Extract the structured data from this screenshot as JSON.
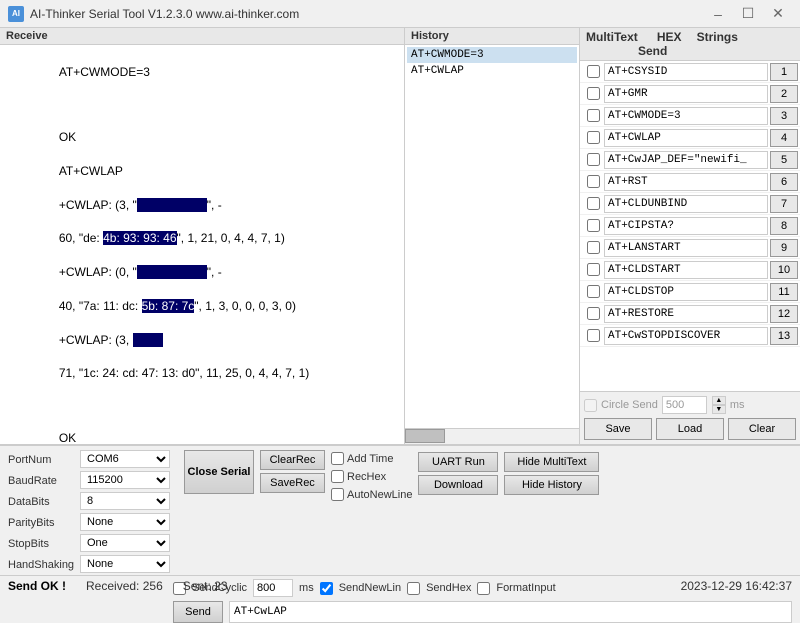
{
  "titlebar": {
    "title": "AI-Thinker Serial Tool V1.2.3.0    www.ai-thinker.com",
    "icon_label": "AI"
  },
  "receive": {
    "label": "Receive",
    "content_lines": [
      "AT+CWMODE=3",
      "",
      "OK",
      "AT+CWLAP",
      "+CWLAP: (3, \"[REDACTED]\", -",
      "60, \"de: 4b: 93: 93: 46\", 1, 21, 0, 4, 4, 7, 1)",
      "+CWLAP: (0, \"[REDACTED]\", -",
      "40, \"7a: 11: dc: 5b: 87: 7c\", 1, 3, 0, 0, 0, 3, 0)",
      "+CWLAP: (3, ",
      "71, \"1c: 24: cd: 47: 13: d0\", 11, 25, 0, 4, 4, 7, 1)",
      "",
      "OK"
    ]
  },
  "history": {
    "label": "History",
    "items": [
      {
        "text": "AT+CWMODE=3",
        "selected": false
      },
      {
        "text": "AT+CWLAP",
        "selected": false
      }
    ]
  },
  "multitext": {
    "label": "MultiText",
    "col_hex": "HEX",
    "col_strings": "Strings",
    "col_send": "Send",
    "rows": [
      {
        "checked": false,
        "value": "AT+CSYSID",
        "send_label": "1"
      },
      {
        "checked": false,
        "value": "AT+GMR",
        "send_label": "2"
      },
      {
        "checked": false,
        "value": "AT+CWMODE=3",
        "send_label": "3"
      },
      {
        "checked": false,
        "value": "AT+CWLAP",
        "send_label": "4"
      },
      {
        "checked": false,
        "value": "AT+CwJAP_DEF=\"newifi_",
        "send_label": "5"
      },
      {
        "checked": false,
        "value": "AT+RST",
        "send_label": "6"
      },
      {
        "checked": false,
        "value": "AT+CLDUNBIND",
        "send_label": "7"
      },
      {
        "checked": false,
        "value": "AT+CIPSTA?",
        "send_label": "8"
      },
      {
        "checked": false,
        "value": "AT+LANSTART",
        "send_label": "9"
      },
      {
        "checked": false,
        "value": "AT+CLDSTART",
        "send_label": "10"
      },
      {
        "checked": false,
        "value": "AT+CLDSTOP",
        "send_label": "11"
      },
      {
        "checked": false,
        "value": "AT+RESTORE",
        "send_label": "12"
      },
      {
        "checked": false,
        "value": "AT+CwSTOPDISCOVER",
        "send_label": "13"
      }
    ],
    "circle_send_label": "Circle Send",
    "circle_send_value": "500",
    "circle_send_ms": "ms",
    "save_btn": "Save",
    "load_btn": "Load",
    "clear_btn": "Clear"
  },
  "settings": {
    "portnum_label": "PortNum",
    "portnum_value": "COM6",
    "baudrate_label": "BaudRate",
    "baudrate_value": "115200",
    "databits_label": "DataBits",
    "databits_value": "8",
    "paritybits_label": "ParityBits",
    "paritybits_value": "None",
    "stopbits_label": "StopBits",
    "stopbits_value": "One",
    "handshaking_label": "HandShaking",
    "handshaking_value": "None"
  },
  "controls": {
    "close_serial_btn": "Close Serial",
    "clearrec_btn": "ClearRec",
    "saverec_btn": "SaveRec",
    "add_time_label": "Add Time",
    "rechex_label": "RecHex",
    "autonewline_label": "AutoNewLine",
    "send_cyclic_label": "SendCyclic",
    "send_cyclic_value": "800",
    "send_cyclic_ms": "ms",
    "send_newlin_label": "SendNewLin",
    "send_hex_label": "SendHex",
    "format_input_label": "FormatInput",
    "uart_run_btn": "UART Run",
    "download_btn": "Download",
    "hide_multitext_btn": "Hide MultiText",
    "hide_history_btn": "Hide History",
    "send_btn": "Send",
    "send_input_value": "AT+CwLAP"
  },
  "statusbar": {
    "send_ok": "Send OK !",
    "received_label": "Received:",
    "received_value": "256",
    "sent_label": "Sent:",
    "sent_value": "23",
    "timestamp": "2023-12-29 16:42:37"
  }
}
